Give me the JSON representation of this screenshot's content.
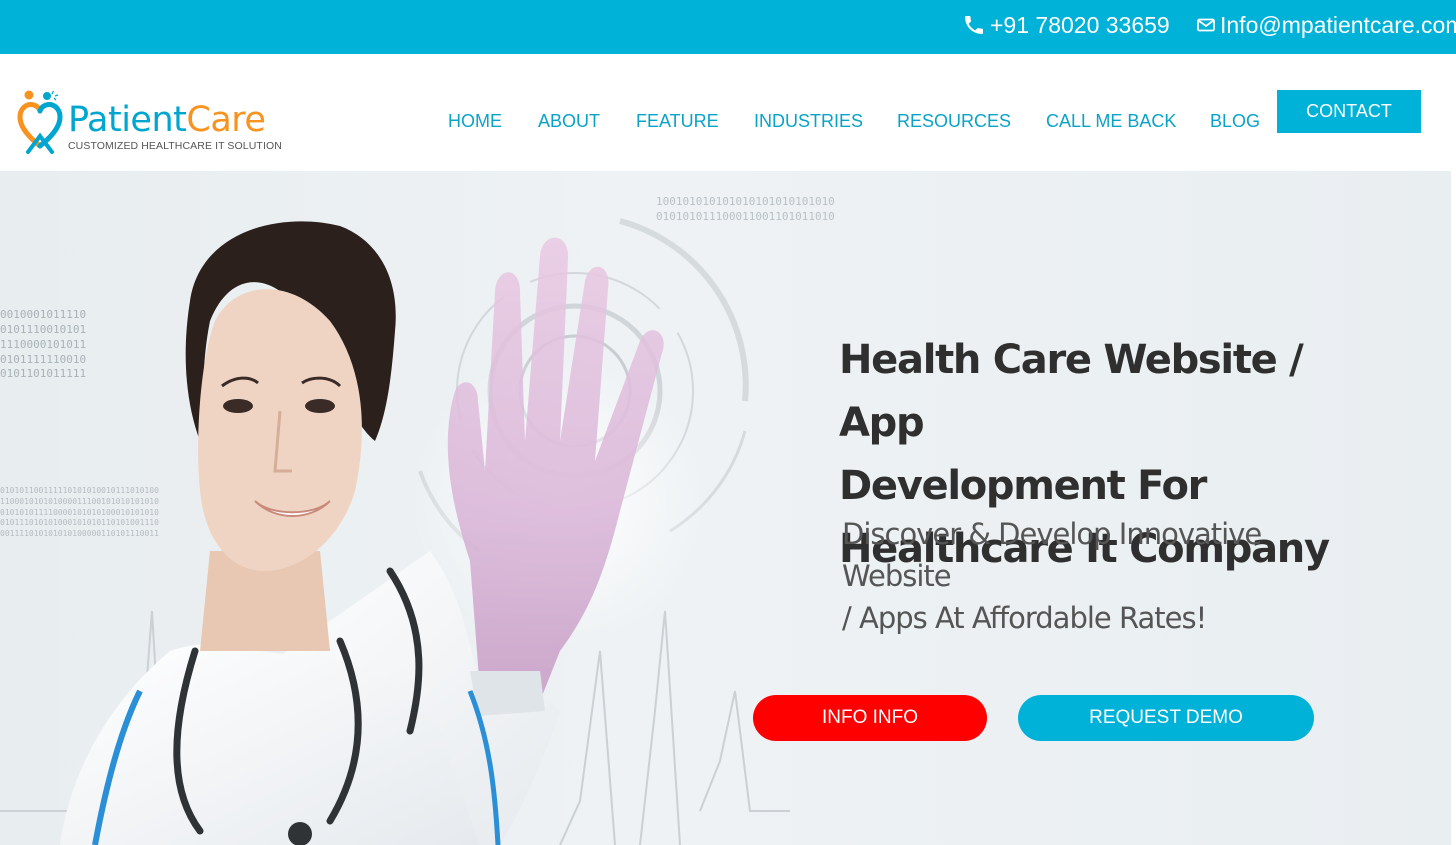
{
  "topbar": {
    "phone": "+91 78020 33659",
    "email": "Info@mpatientcare.com",
    "phone_icon": "phone-icon",
    "email_icon": "envelope-icon"
  },
  "logo": {
    "name_part1": "Patient",
    "name_part2": "Care",
    "tagline": "CUSTOMIZED HEALTHCARE IT SOLUTION",
    "icon": "heart-people-logo-icon"
  },
  "nav": {
    "items": [
      {
        "label": "HOME"
      },
      {
        "label": "ABOUT"
      },
      {
        "label": "FEATURE"
      },
      {
        "label": "INDUSTRIES"
      },
      {
        "label": "RESOURCES"
      },
      {
        "label": "CALL ME BACK"
      },
      {
        "label": "BLOG"
      }
    ],
    "contact_label": "CONTACT"
  },
  "hero": {
    "headline_line1": "Health Care Website / App",
    "headline_line2": "Development For",
    "headline_line3": "Healthcare It Company",
    "subline_line1": "Discover & Develop Innovative Website",
    "subline_line2": "/ Apps At Affordable Rates!",
    "info_button": "INFO INFO",
    "demo_button": "REQUEST DEMO",
    "binary_a": "0010001011110\n0101110010101\n1110000101011\n0101111110010\n0101101011111",
    "binary_b": "010101100111110101010010111010100\n110001010101000011100101010101010\n010101011110000101010100010101010\n010111010101000101010110101001110\n001111010101010100000110101110011",
    "binary_c": "100101010101010101010101010\n010101011100011001101011010"
  },
  "colors": {
    "accent": "#00b1d8",
    "nav_text": "#0aa3c8",
    "logo_orange": "#f7931e",
    "info_button": "#ff0000"
  }
}
